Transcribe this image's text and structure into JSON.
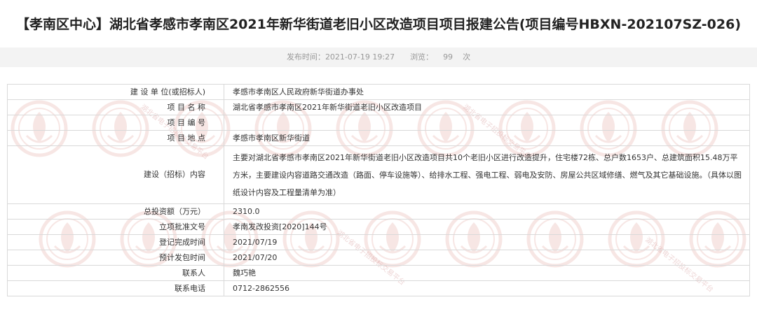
{
  "page": {
    "title": "【孝南区中心】湖北省孝感市孝南区2021年新华街道老旧小区改造项目项目报建公告(项目编号HBXN-202107SZ-026)",
    "publish_label": "发布时间：",
    "publish_time": "2021-07-19 19:27",
    "views_label": "浏览：",
    "views_count": "99",
    "views_unit": "次"
  },
  "watermark": {
    "text": "湖北省电子招投标交易平台",
    "color": "#c0392b"
  },
  "table": {
    "rows": [
      {
        "label": "建 设 单 位(或招标人)",
        "value": "孝感市孝南区人民政府新华街道办事处"
      },
      {
        "label": "项 目 名 称",
        "value": "湖北省孝感市孝南区2021年新华街道老旧小区改造项目"
      },
      {
        "label": "项 目 编 号",
        "value": ""
      },
      {
        "label": "项 目 地 点",
        "value": "孝感市孝南区新华街道"
      },
      {
        "label": "建设（招标）内容",
        "value": "主要对湖北省孝感市孝南区2021年新华街道老旧小区改造项目共10个老旧小区进行改造提升，住宅楼72栋、总户数1653户、总建筑面积15.48万平方米，主要建设内容道路交通改造（路面、停车设施等）、给排水工程、强电工程、弱电及安防、房屋公共区域修缮、燃气及其它基础设施。（具体以图纸设计内容及工程量清单为准）"
      },
      {
        "label": "总投资额（万元）",
        "value": "2310.0"
      },
      {
        "label": "立项批准文号",
        "value": "孝南发改投资[2020]144号"
      },
      {
        "label": "登记完成时间",
        "value": "2021/07/19"
      },
      {
        "label": "预计发包时间",
        "value": "2021/07/20"
      },
      {
        "label": "联系人",
        "value": "魏巧艳"
      },
      {
        "label": "联系电话",
        "value": "0712-2862556"
      }
    ]
  }
}
